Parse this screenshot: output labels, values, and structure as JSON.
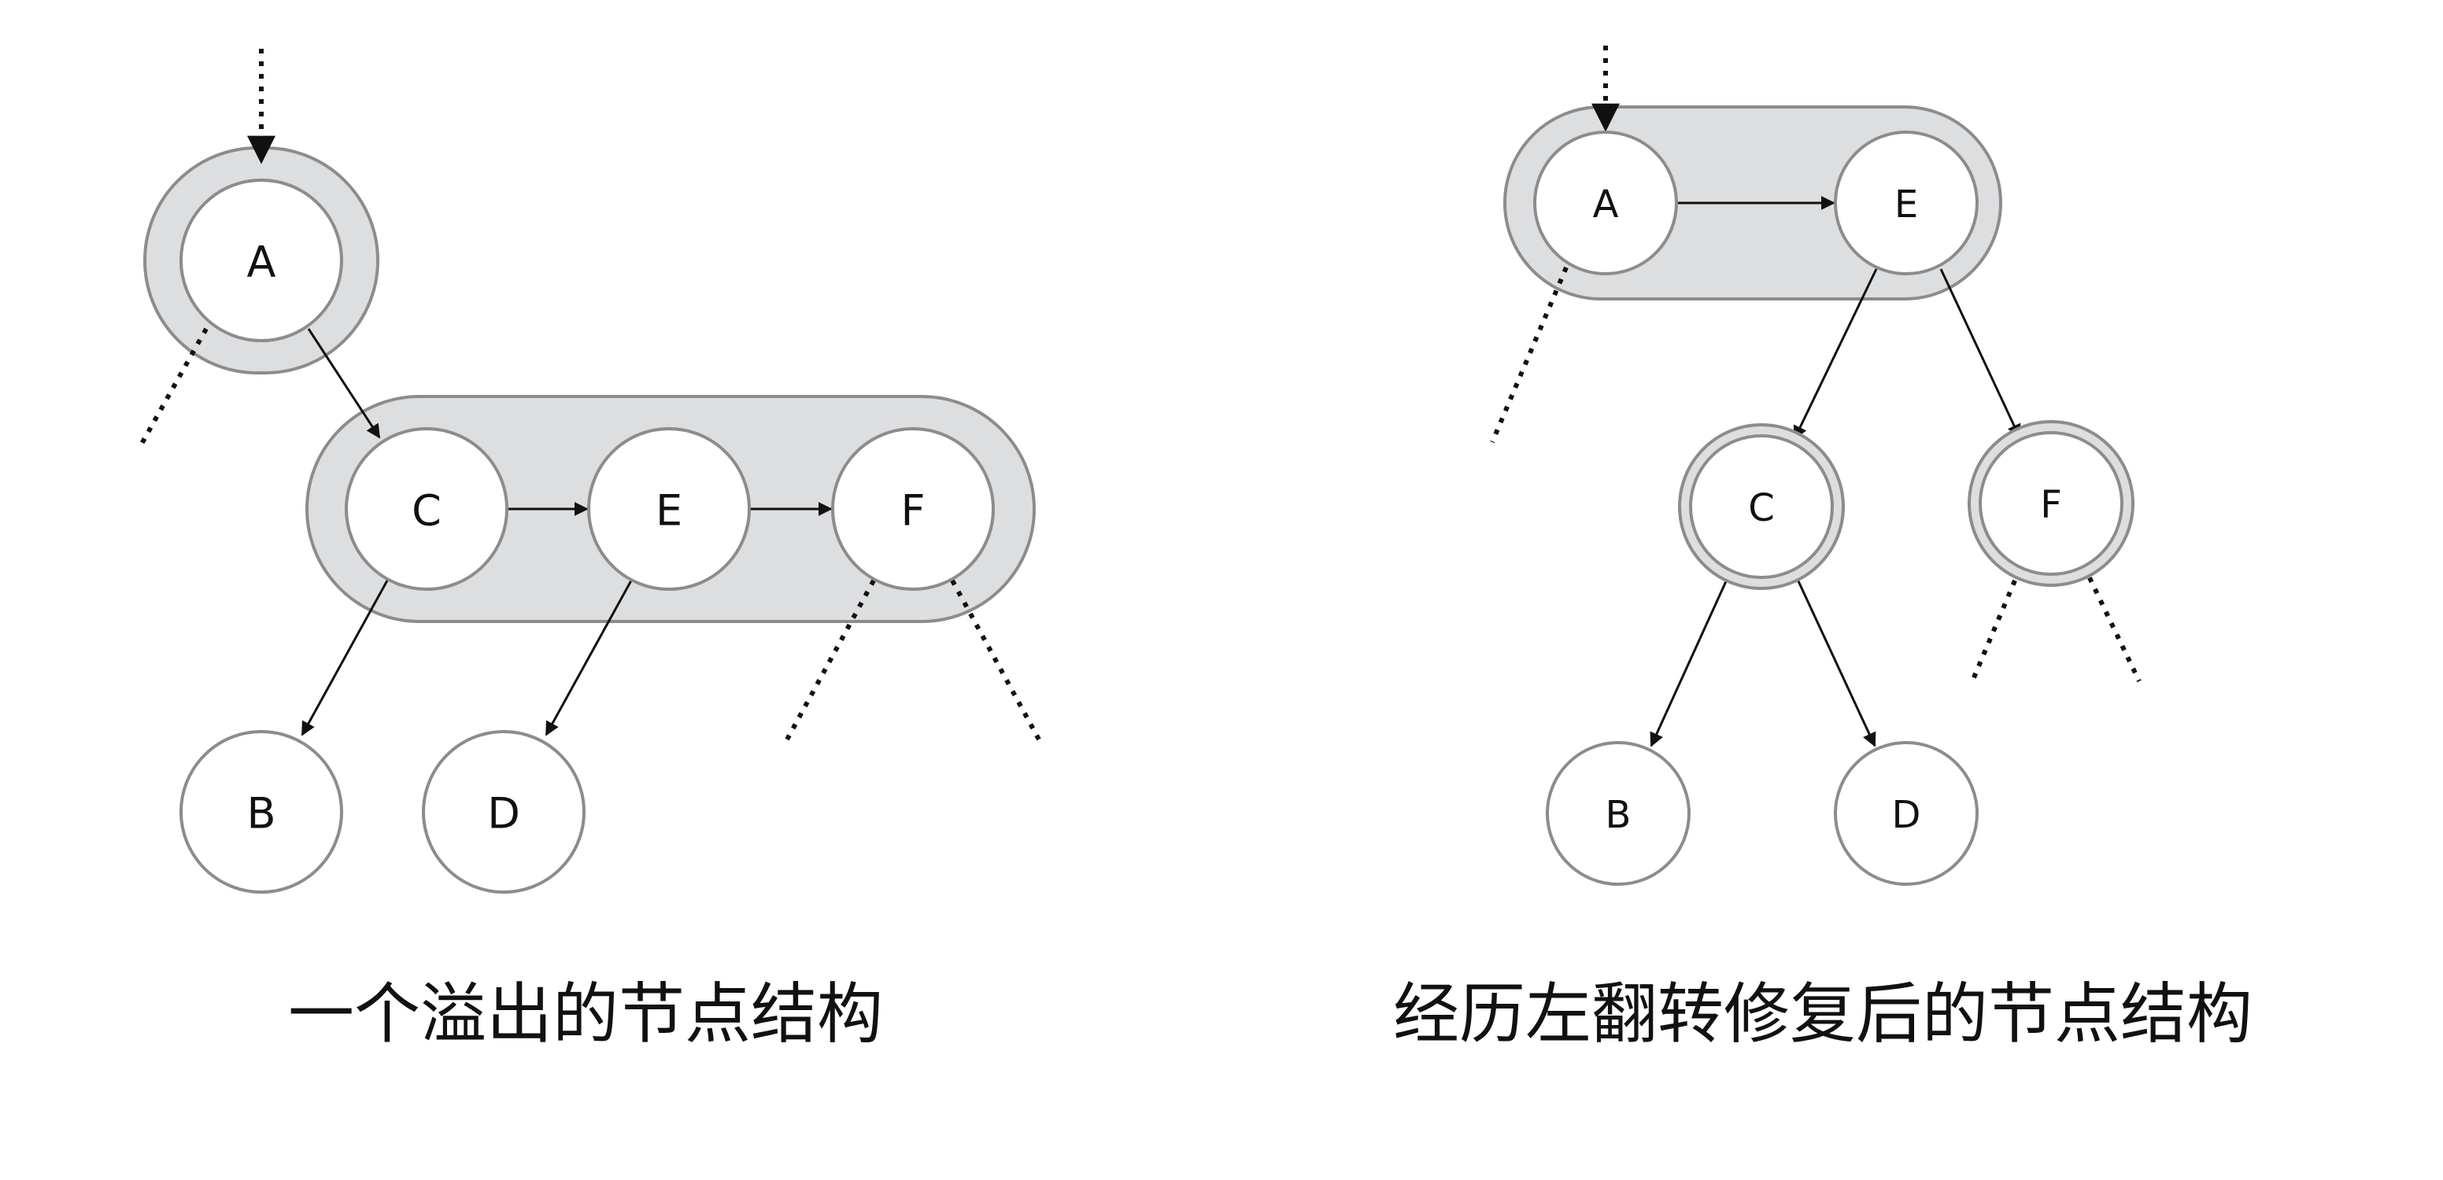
{
  "left_diagram": {
    "caption": "一个溢出的节点结构",
    "nodes": {
      "A": "A",
      "B": "B",
      "C": "C",
      "D": "D",
      "E": "E",
      "F": "F"
    }
  },
  "right_diagram": {
    "caption": "经历左翻转修复后的节点结构",
    "nodes": {
      "A": "A",
      "B": "B",
      "C": "C",
      "D": "D",
      "E": "E",
      "F": "F"
    }
  },
  "colors": {
    "group_fill": "#dddee0",
    "outline": "#8c8c8c",
    "edge": "#111111"
  }
}
